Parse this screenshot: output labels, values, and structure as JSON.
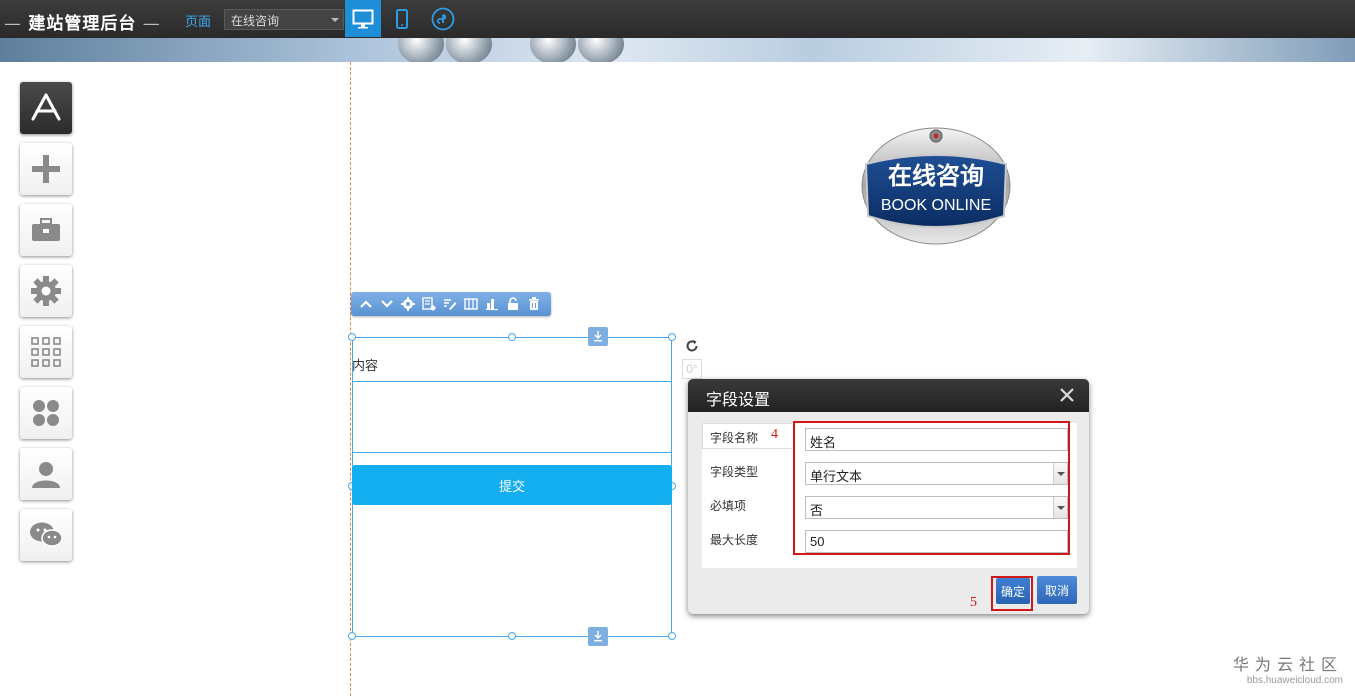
{
  "header": {
    "app_title": "建站管理后台",
    "page_label": "页面",
    "page_select_value": "在线咨询",
    "devices": [
      {
        "name": "desktop",
        "icon": "desktop-icon",
        "active": true
      },
      {
        "name": "mobile",
        "icon": "mobile-icon",
        "active": false
      },
      {
        "name": "mini-program",
        "icon": "miniprogram-icon",
        "active": false
      }
    ]
  },
  "sidebar": {
    "items": [
      {
        "icon": "app-store-icon",
        "active": true
      },
      {
        "icon": "plus-icon"
      },
      {
        "icon": "toolbox-icon"
      },
      {
        "icon": "gear-icon"
      },
      {
        "icon": "grid-icon"
      },
      {
        "icon": "clover-icon"
      },
      {
        "icon": "user-icon"
      },
      {
        "icon": "wechat-icon"
      }
    ]
  },
  "badge": {
    "cn_text": "在线咨询",
    "en_text": "BOOK ONLINE"
  },
  "form": {
    "content_label": "内容",
    "submit_label": "提交",
    "rotation_degree": "0°"
  },
  "dialog": {
    "title": "字段设置",
    "fields": [
      {
        "label": "字段名称",
        "value": "姓名",
        "type": "text"
      },
      {
        "label": "字段类型",
        "value": "单行文本",
        "type": "select"
      },
      {
        "label": "必填项",
        "value": "否",
        "type": "select"
      },
      {
        "label": "最大长度",
        "value": "50",
        "type": "text"
      }
    ],
    "confirm_label": "确定",
    "cancel_label": "取消"
  },
  "annotations": {
    "step4": "4",
    "step5": "5"
  },
  "watermark": {
    "main": "华为云社区",
    "sub": "bbs.huaweicloud.com"
  },
  "colors": {
    "accent": "#1e8ed8",
    "submit": "#12aef0",
    "annotation": "#d01818"
  }
}
